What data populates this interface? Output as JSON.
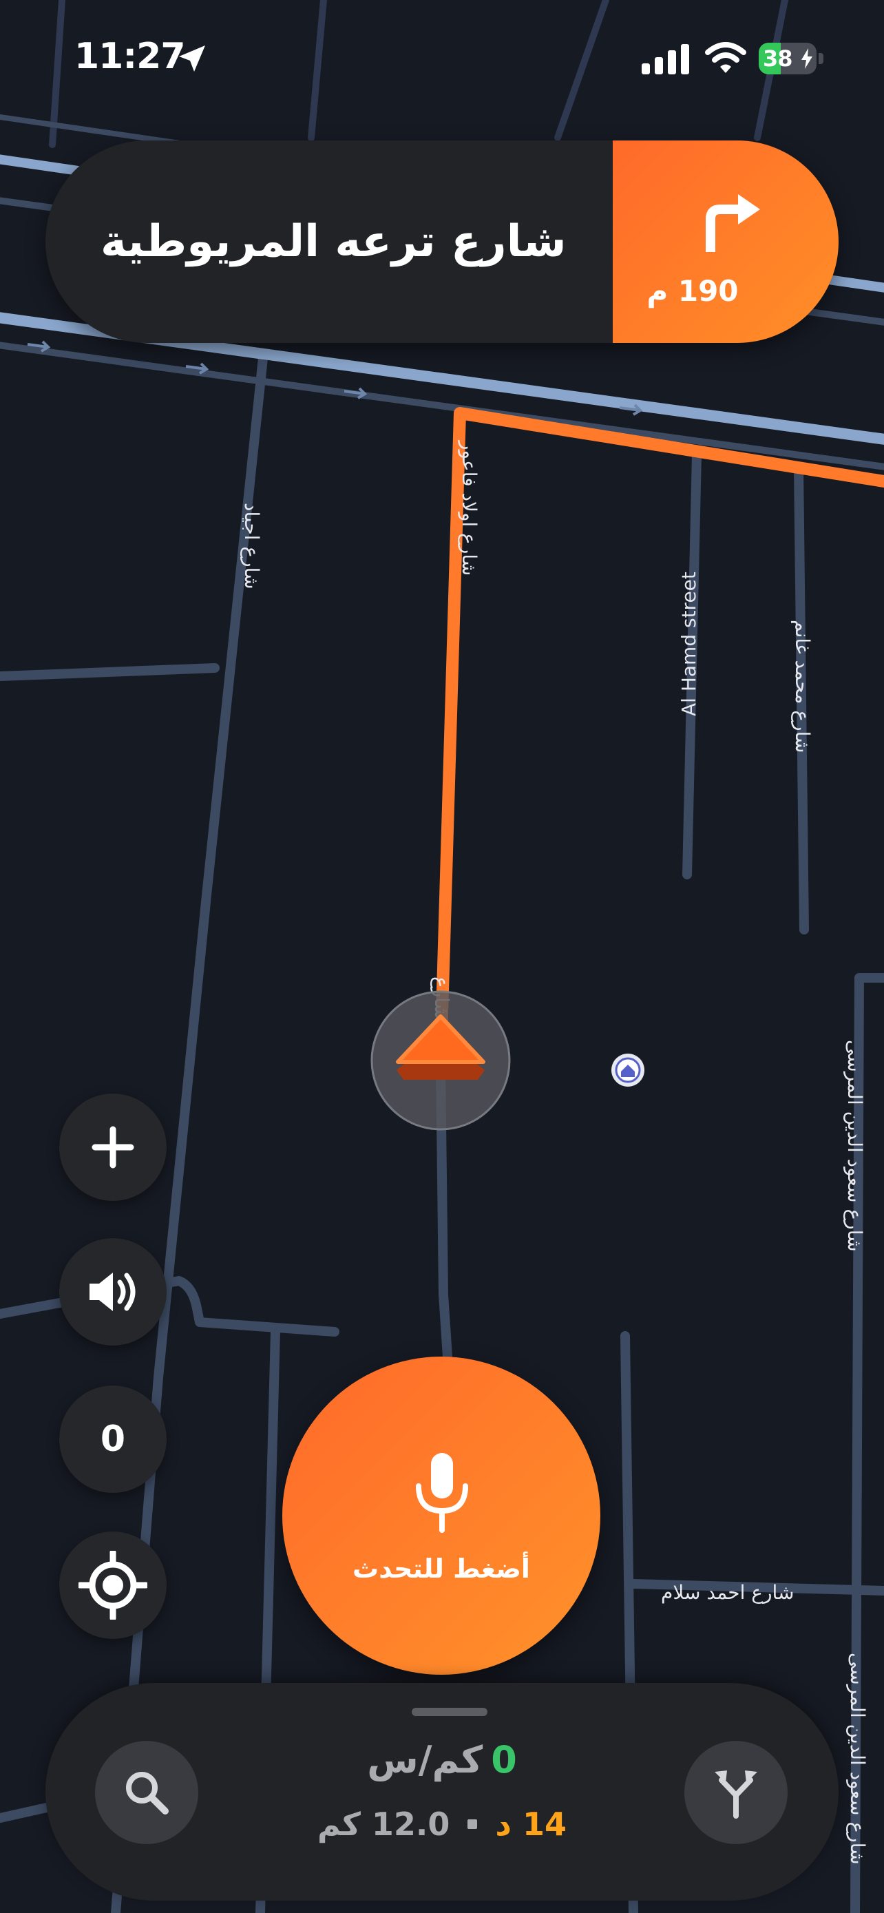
{
  "status_bar": {
    "time": "11:27",
    "battery_percent": "38",
    "battery_level": 0.38,
    "icons": [
      "location-arrow-icon",
      "cellular-signal-icon",
      "wifi-icon",
      "battery-charging-icon"
    ]
  },
  "navigation": {
    "street_name": "شارع ترعه المريوطية",
    "turn_distance": "190 م",
    "turn_direction": "right",
    "turn_icon": "turn-right-icon"
  },
  "map": {
    "street_labels": {
      "awlad_faour": "شارع اولاد فاعور",
      "awlad_faour_short": "شارع",
      "awlad_faour_lower": "اولاد فاعور",
      "ijad": "شارع اجياد",
      "al_hamd": "Al Hamd street",
      "mohamed_ghanem": "شارع محمد غانم",
      "ahmed_salam": "شارع احمد سلام",
      "saud_aldin_1": "شارع سعود الدين المرسى",
      "saud_aldin_2": "شارع سعود الدين المرسى"
    },
    "route_color": "#ff7a2a",
    "poi_icon": "home-pin-icon"
  },
  "controls": {
    "zoom_icon": "plus-icon",
    "volume_icon": "speaker-icon",
    "counter_value": "0",
    "recenter_icon": "crosshair-icon"
  },
  "talk": {
    "label": "أضغط للتحدث",
    "icon": "microphone-icon"
  },
  "trip": {
    "speed_value": "0",
    "speed_unit": "كم/س",
    "eta": "14 د",
    "distance": "12.0 كم",
    "search_icon": "search-icon",
    "routes_icon": "route-fork-icon"
  },
  "colors": {
    "accent": "#ff7a2a",
    "speed": "#3ac46a",
    "eta": "#ffa31a",
    "map_background": "#161a23",
    "road": "#3c4a62",
    "major_road": "#8aa6cc"
  }
}
